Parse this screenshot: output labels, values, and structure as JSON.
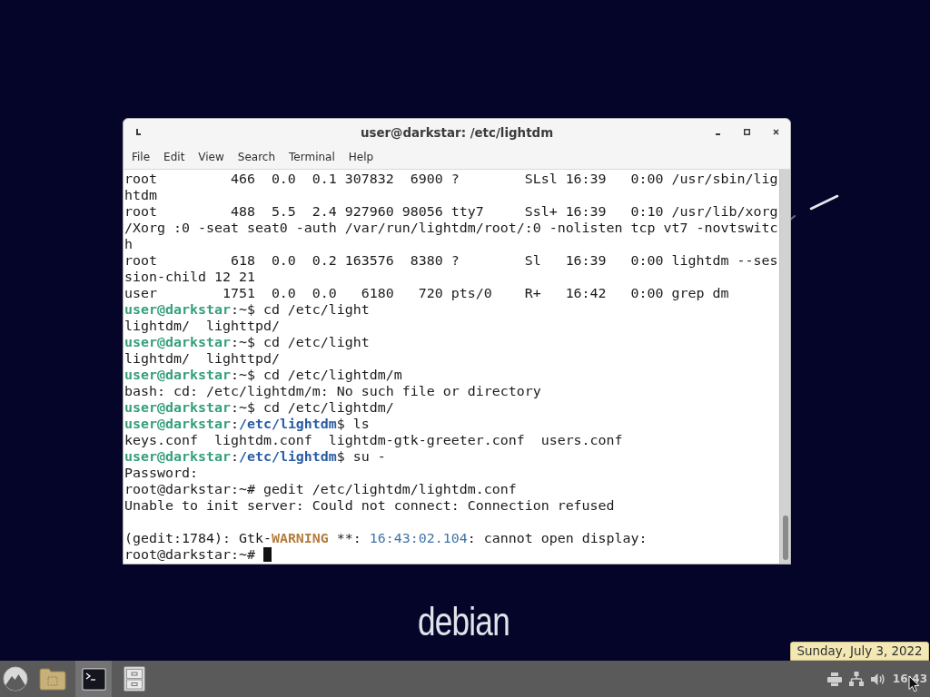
{
  "desktop": {
    "logo_text": "debian"
  },
  "window": {
    "title": "user@darkstar: /etc/lightdm",
    "menu": [
      "File",
      "Edit",
      "View",
      "Search",
      "Terminal",
      "Help"
    ]
  },
  "terminal": {
    "cursor_shown": true,
    "lines": [
      {
        "kind": "text",
        "segments": [
          {
            "kind": "plain",
            "text": "root         466  0.0  0.1 307832  6900 ?        SLsl 16:39   0:00 /usr/sbin/lig"
          }
        ]
      },
      {
        "kind": "text",
        "segments": [
          {
            "kind": "plain",
            "text": "htdm"
          }
        ]
      },
      {
        "kind": "text",
        "segments": [
          {
            "kind": "plain",
            "text": "root         488  5.5  2.4 927960 98056 tty7     Ssl+ 16:39   0:10 /usr/lib/xorg"
          }
        ]
      },
      {
        "kind": "text",
        "segments": [
          {
            "kind": "plain",
            "text": "/Xorg :0 -seat seat0 -auth /var/run/lightdm/root/:0 -nolisten tcp vt7 -novtswitc"
          }
        ]
      },
      {
        "kind": "text",
        "segments": [
          {
            "kind": "plain",
            "text": "h"
          }
        ]
      },
      {
        "kind": "text",
        "segments": [
          {
            "kind": "plain",
            "text": "root         618  0.0  0.2 163576  8380 ?        Sl   16:39   0:00 lightdm --ses"
          }
        ]
      },
      {
        "kind": "text",
        "segments": [
          {
            "kind": "plain",
            "text": "sion-child 12 21"
          }
        ]
      },
      {
        "kind": "text",
        "segments": [
          {
            "kind": "plain",
            "text": "user        1751  0.0  0.0   6180   720 pts/0    R+   16:42   0:00 grep dm"
          }
        ]
      },
      {
        "kind": "text",
        "segments": [
          {
            "kind": "user",
            "text": "user@darkstar"
          },
          {
            "kind": "plain",
            "text": ":~$ cd /etc/light"
          }
        ]
      },
      {
        "kind": "text",
        "segments": [
          {
            "kind": "plain",
            "text": "lightdm/  lighttpd/"
          }
        ]
      },
      {
        "kind": "text",
        "segments": [
          {
            "kind": "user",
            "text": "user@darkstar"
          },
          {
            "kind": "plain",
            "text": ":~$ cd /etc/light"
          }
        ]
      },
      {
        "kind": "text",
        "segments": [
          {
            "kind": "plain",
            "text": "lightdm/  lighttpd/"
          }
        ]
      },
      {
        "kind": "text",
        "segments": [
          {
            "kind": "user",
            "text": "user@darkstar"
          },
          {
            "kind": "plain",
            "text": ":~$ cd /etc/lightdm/m"
          }
        ]
      },
      {
        "kind": "text",
        "segments": [
          {
            "kind": "plain",
            "text": "bash: cd: /etc/lightdm/m: No such file or directory"
          }
        ]
      },
      {
        "kind": "text",
        "segments": [
          {
            "kind": "user",
            "text": "user@darkstar"
          },
          {
            "kind": "plain",
            "text": ":~$ cd /etc/lightdm/"
          }
        ]
      },
      {
        "kind": "text",
        "segments": [
          {
            "kind": "user",
            "text": "user@darkstar"
          },
          {
            "kind": "plain",
            "text": ":"
          },
          {
            "kind": "path",
            "text": "/etc/lightdm"
          },
          {
            "kind": "plain",
            "text": "$ ls"
          }
        ]
      },
      {
        "kind": "text",
        "segments": [
          {
            "kind": "plain",
            "text": "keys.conf  lightdm.conf  lightdm-gtk-greeter.conf  users.conf"
          }
        ]
      },
      {
        "kind": "text",
        "segments": [
          {
            "kind": "user",
            "text": "user@darkstar"
          },
          {
            "kind": "plain",
            "text": ":"
          },
          {
            "kind": "path",
            "text": "/etc/lightdm"
          },
          {
            "kind": "plain",
            "text": "$ su -"
          }
        ]
      },
      {
        "kind": "text",
        "segments": [
          {
            "kind": "plain",
            "text": "Password:"
          }
        ]
      },
      {
        "kind": "text",
        "segments": [
          {
            "kind": "plain",
            "text": "root@darkstar:~# gedit /etc/lightdm/lightdm.conf"
          }
        ]
      },
      {
        "kind": "text",
        "segments": [
          {
            "kind": "plain",
            "text": "Unable to init server: Could not connect: Connection refused"
          }
        ]
      },
      {
        "kind": "blank"
      },
      {
        "kind": "text",
        "segments": [
          {
            "kind": "plain",
            "text": "(gedit:1784): Gtk-"
          },
          {
            "kind": "warning",
            "text": "WARNING"
          },
          {
            "kind": "plain",
            "text": " **: "
          },
          {
            "kind": "time",
            "text": "16:43:02.104"
          },
          {
            "kind": "plain",
            "text": ": cannot open display:"
          }
        ]
      },
      {
        "kind": "text",
        "segments": [
          {
            "kind": "plain",
            "text": "root@darkstar:~#"
          }
        ]
      }
    ]
  },
  "taskbar": {
    "launchers": [
      {
        "kind": "menu",
        "active": false
      },
      {
        "kind": "folder",
        "active": false
      },
      {
        "kind": "terminal",
        "active": true
      },
      {
        "kind": "cabinet",
        "active": false
      }
    ],
    "tray": [
      {
        "kind": "printer"
      },
      {
        "kind": "network"
      },
      {
        "kind": "volume"
      }
    ],
    "clock": "16:43",
    "tooltip": "Sunday, July 3, 2022"
  }
}
